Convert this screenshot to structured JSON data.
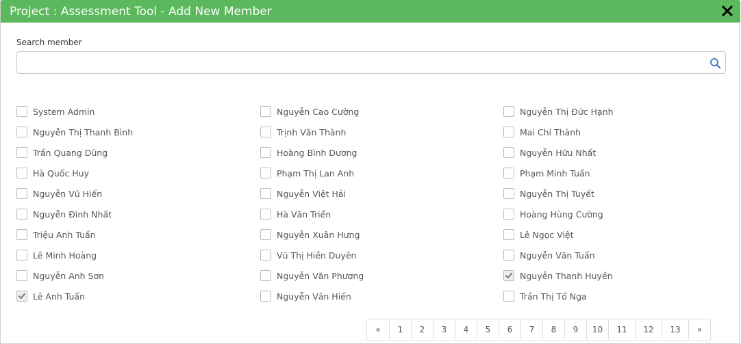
{
  "dialog": {
    "title": "Project : Assessment Tool - Add New Member",
    "header_color": "#5cb85c"
  },
  "search": {
    "label": "Search member",
    "value": "",
    "placeholder": ""
  },
  "members": {
    "col1": [
      {
        "name": "System Admin",
        "checked": false
      },
      {
        "name": "Nguyễn Thị Thanh Bình",
        "checked": false
      },
      {
        "name": "Trần Quang Dũng",
        "checked": false
      },
      {
        "name": "Hà Quốc Huy",
        "checked": false
      },
      {
        "name": "Nguyễn Vũ Hiển",
        "checked": false
      },
      {
        "name": "Nguyễn Đình Nhất",
        "checked": false
      },
      {
        "name": "Triệu Anh Tuấn",
        "checked": false
      },
      {
        "name": "Lê Minh Hoàng",
        "checked": false
      },
      {
        "name": "Nguyễn Anh Sơn",
        "checked": false
      },
      {
        "name": "Lê Anh Tuấn",
        "checked": true
      }
    ],
    "col2": [
      {
        "name": "Nguyễn Cao Cường",
        "checked": false
      },
      {
        "name": "Trịnh Văn Thành",
        "checked": false
      },
      {
        "name": "Hoàng Bình Dương",
        "checked": false
      },
      {
        "name": "Phạm Thị Lan Anh",
        "checked": false
      },
      {
        "name": "Nguyễn Việt Hải",
        "checked": false
      },
      {
        "name": "Hà Văn Triển",
        "checked": false
      },
      {
        "name": "Nguyễn Xuân Hưng",
        "checked": false
      },
      {
        "name": "Vũ Thị Hiền Duyên",
        "checked": false
      },
      {
        "name": "Nguyễn Văn Phương",
        "checked": false
      },
      {
        "name": "Nguyễn Văn Hiến",
        "checked": false
      }
    ],
    "col3": [
      {
        "name": "Nguyễn Thị Đức Hạnh",
        "checked": false
      },
      {
        "name": "Mai Chí Thành",
        "checked": false
      },
      {
        "name": "Nguyễn Hữu Nhất",
        "checked": false
      },
      {
        "name": "Phạm Minh Tuấn",
        "checked": false
      },
      {
        "name": "Nguyễn Thị Tuyết",
        "checked": false
      },
      {
        "name": "Hoàng Hùng Cường",
        "checked": false
      },
      {
        "name": "Lê Ngọc Việt",
        "checked": false
      },
      {
        "name": "Nguyễn Văn Tuấn",
        "checked": false
      },
      {
        "name": "Nguyễn Thanh Huyền",
        "checked": true
      },
      {
        "name": "Trần Thị Tố Nga",
        "checked": false
      }
    ]
  },
  "pagination": {
    "prev": "«",
    "pages": [
      "1",
      "2",
      "3",
      "4",
      "5",
      "6",
      "7",
      "8",
      "9",
      "10",
      "11",
      "12",
      "13"
    ],
    "next": "»"
  },
  "icons": {
    "close": "close-icon",
    "search": "search-icon",
    "check": "checkmark-icon"
  }
}
